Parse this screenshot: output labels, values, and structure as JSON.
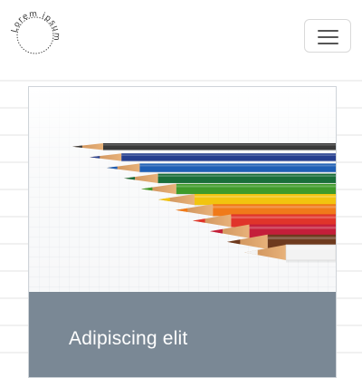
{
  "logo": {
    "text": "Lorem ipsum",
    "icon": "circle-text-logo"
  },
  "nav": {
    "toggle_icon": "hamburger-icon",
    "toggle_border_color": "#d9d9d9"
  },
  "card": {
    "title": "Adipiscing elit",
    "image_subject": "colored-pencils-on-grid-paper",
    "footer_color": "#7a8895"
  },
  "colors": {
    "pencils": [
      "#3a3a3a",
      "#263f8f",
      "#1f5fb5",
      "#1a6e3a",
      "#3f9b2b",
      "#f2c40f",
      "#f07a1a",
      "#e0342a",
      "#c41e3a",
      "#6e3a1e",
      "#f3f3f3"
    ]
  }
}
